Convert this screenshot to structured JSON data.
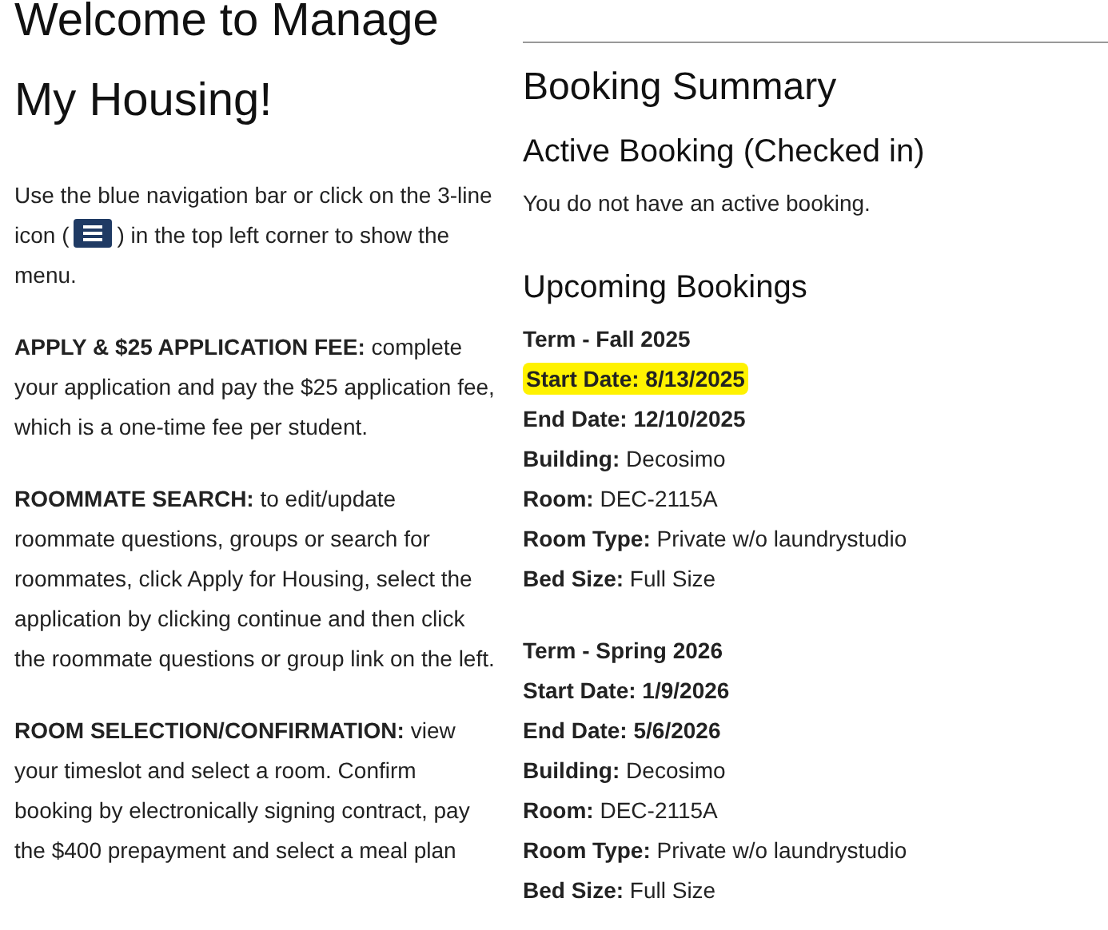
{
  "welcome": {
    "title": "Welcome to Manage My Housing!",
    "intro": {
      "before_icon": "Use the blue navigation bar or click on the 3-line icon (",
      "after_icon": ") in the top left corner to show the menu."
    },
    "paragraphs": [
      "**APPLY & $25 APPLICATION FEE:** complete your application and pay the $25 application fee, which is a one-time fee per student.",
      "**ROOMMATE SEARCH:** to edit/update roommate questions, groups or search for roommates, click Apply for Housing, select the application by clicking continue and then click the roommate questions or group link on the left.",
      "**ROOM SELECTION/CONFIRMATION:** view your timeslot and select a room. Confirm booking by electronically signing contract, pay the $400 prepayment and select a meal plan"
    ]
  },
  "booking_summary": {
    "title": "Booking Summary",
    "active_title": "Active Booking (Checked in)",
    "active_text": "You do not have an active booking.",
    "upcoming_title": "Upcoming Bookings",
    "bookings": [
      {
        "lines": [
          {
            "text": "Term - Fall 2025",
            "bold": true,
            "highlighted": false
          },
          {
            "text": "Start Date: 8/13/2025",
            "bold": true,
            "highlighted": true
          },
          {
            "text": "End Date: 12/10/2025",
            "bold": true,
            "highlighted": false
          },
          {
            "text": "**Building:** Decosimo",
            "bold": false,
            "highlighted": false
          },
          {
            "text": "**Room:** DEC-2115A",
            "bold": false,
            "highlighted": false
          },
          {
            "text": "**Room Type:** Private w/o laundrystudio",
            "bold": false,
            "highlighted": false
          },
          {
            "text": "**Bed Size:** Full Size",
            "bold": false,
            "highlighted": false
          }
        ]
      },
      {
        "lines": [
          {
            "text": "Term - Spring 2026",
            "bold": true,
            "highlighted": false
          },
          {
            "text": "Start Date: 1/9/2026",
            "bold": true,
            "highlighted": false
          },
          {
            "text": "End Date: 5/6/2026",
            "bold": true,
            "highlighted": false
          },
          {
            "text": "**Building:** Decosimo",
            "bold": false,
            "highlighted": false
          },
          {
            "text": "**Room:** DEC-2115A",
            "bold": false,
            "highlighted": false
          },
          {
            "text": "**Room Type:** Private w/o laundrystudio",
            "bold": false,
            "highlighted": false
          },
          {
            "text": "**Bed Size:** Full Size",
            "bold": false,
            "highlighted": false
          }
        ]
      }
    ]
  }
}
